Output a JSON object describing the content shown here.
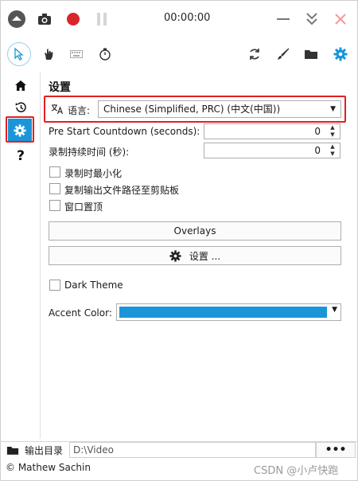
{
  "toolbar": {
    "timer": "00:00:00"
  },
  "settings": {
    "title": "设置",
    "language_label": "语言:",
    "language_value": "Chinese (Simplified, PRC) (中文(中国))",
    "pre_start_label": "Pre Start Countdown (seconds):",
    "pre_start_value": "0",
    "duration_label": "录制持续时间 (秒):",
    "duration_value": "0",
    "minimize_label": "录制时最小化",
    "copy_path_label": "复制输出文件路径至剪贴板",
    "topmost_label": "窗口置顶",
    "overlays_label": "Overlays",
    "settings_button_label": "设置 ...",
    "dark_theme_label": "Dark Theme",
    "accent_label": "Accent Color:",
    "accent_color": "#1a96d8"
  },
  "footer": {
    "output_label": "输出目录",
    "output_path": "D:\\Video",
    "more_label": "•••",
    "copyright": "© Mathew Sachin",
    "watermark": "CSDN @小卢快跑"
  },
  "colors": {
    "accent": "#1a96d8",
    "record": "#d9262c",
    "highlight": "#e02020"
  },
  "icons": [
    "eject-icon",
    "camera-icon",
    "record-icon",
    "pause-icon",
    "minimize-icon",
    "collapse-icon",
    "close-icon",
    "pointer-icon",
    "hand-icon",
    "keyboard-icon",
    "stopwatch-icon",
    "refresh-icon",
    "brush-icon",
    "folder-icon",
    "gear-icon",
    "home-icon",
    "history-icon",
    "help-icon",
    "translate-icon"
  ]
}
